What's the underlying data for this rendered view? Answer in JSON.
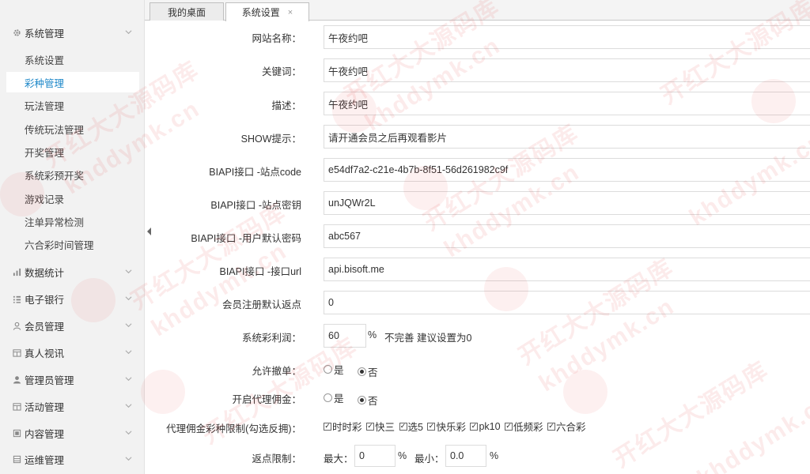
{
  "tabs": [
    {
      "label": "我的桌面"
    },
    {
      "label": "系统设置",
      "close": "×"
    }
  ],
  "sidebar": {
    "system": {
      "label": "系统管理",
      "items": [
        {
          "label": "系统设置"
        },
        {
          "label": "彩种管理"
        },
        {
          "label": "玩法管理"
        },
        {
          "label": "传统玩法管理"
        },
        {
          "label": "开奖管理"
        },
        {
          "label": "系统彩预开奖"
        },
        {
          "label": "游戏记录"
        },
        {
          "label": "注单异常检测"
        },
        {
          "label": "六合彩时间管理"
        }
      ]
    },
    "groups": [
      {
        "label": "数据统计",
        "icon": "bar-chart-icon"
      },
      {
        "label": "电子银行",
        "icon": "list-icon"
      },
      {
        "label": "会员管理",
        "icon": "user-icon"
      },
      {
        "label": "真人视讯",
        "icon": "grid-icon"
      },
      {
        "label": "管理员管理",
        "icon": "admin-icon"
      },
      {
        "label": "活动管理",
        "icon": "grid-icon"
      },
      {
        "label": "内容管理",
        "icon": "document-icon"
      },
      {
        "label": "运维管理",
        "icon": "server-icon"
      }
    ]
  },
  "form": {
    "site_name": {
      "label": "网站名称：",
      "value": "午夜约吧"
    },
    "keywords": {
      "label": "关键词：",
      "value": "午夜约吧"
    },
    "description": {
      "label": "描述：",
      "value": "午夜约吧"
    },
    "show_tip": {
      "label": "SHOW提示：",
      "value": "请开通会员之后再观看影片"
    },
    "api_site_code": {
      "label": "BIAPI接口 -站点code",
      "value": "e54df7a2-c21e-4b7b-8f51-56d261982c9f"
    },
    "api_site_key": {
      "label": "BIAPI接口 -站点密钥",
      "value": "unJQWr2L"
    },
    "api_user_pwd": {
      "label": "BIAPI接口 -用户默认密码",
      "value": "abc567"
    },
    "api_url": {
      "label": "BIAPI接口 -接口url",
      "value": "api.bisoft.me"
    },
    "member_rebate": {
      "label": "会员注册默认返点",
      "value": "0"
    },
    "profit": {
      "label": "系统彩利润：",
      "value": "60",
      "unit": "%",
      "hint": "不完善 建议设置为0"
    },
    "allow_cancel": {
      "label": "允许撤单：",
      "yes": "是",
      "no": "否",
      "selected": "否"
    },
    "agent_commission": {
      "label": "开启代理佣金：",
      "yes": "是",
      "no": "否",
      "selected": "否"
    },
    "commission_limit": {
      "label": "代理佣金彩种限制(勾选反拥)：",
      "options": [
        "时时彩",
        "快三",
        " 选5",
        "快乐彩",
        "pk10",
        "低频彩",
        "六合彩"
      ]
    },
    "rebate_limit": {
      "label": "返点限制：",
      "max_label": "最大：",
      "max_value": "0",
      "min_label": "最小：",
      "min_value": "0.0",
      "unit": "%"
    }
  },
  "watermark": {
    "cn": "开红大大源码库",
    "en": "khddymk.cn"
  }
}
